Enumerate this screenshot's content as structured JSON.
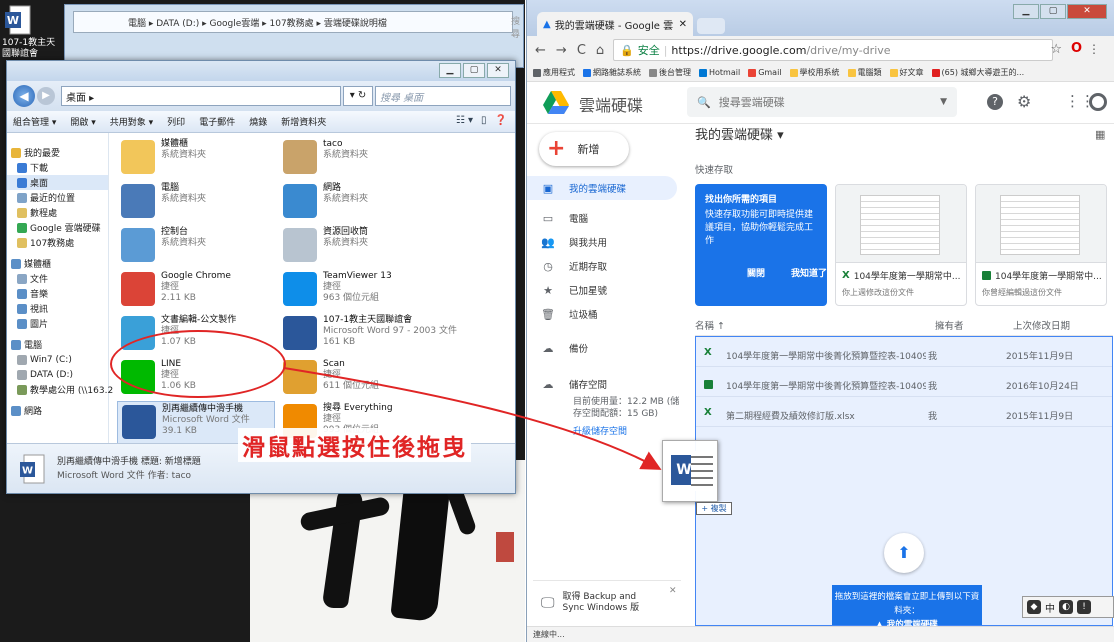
{
  "desktop": {
    "word_icon_label": "107-1教主天\n國聯誼會"
  },
  "bg_window": {
    "path": "電腦 ▸ DATA (D:) ▸ Google雲端 ▸ 107教務處 ▸ 雲端硬碟說明檔",
    "search": "搜尋"
  },
  "explorer": {
    "path": "桌面 ▸",
    "search_placeholder": "搜尋 桌面",
    "toolbar": [
      "組合管理 ▾",
      "開啟 ▾",
      "共用對象 ▾",
      "列印",
      "電子郵件",
      "燒錄",
      "新增資料夾"
    ],
    "nav": [
      {
        "label": "我的最愛",
        "group": true,
        "color": "#e8b53a"
      },
      {
        "label": "下載",
        "color": "#3a7bd5"
      },
      {
        "label": "桌面",
        "sel": true,
        "color": "#3a7bd5"
      },
      {
        "label": "最近的位置",
        "color": "#7fa3c8"
      },
      {
        "label": "數程處",
        "color": "#e0c060"
      },
      {
        "label": "Google 雲端硬碟",
        "color": "#34a853"
      },
      {
        "label": "107教務處",
        "color": "#e0c060"
      },
      {
        "label": "媒體櫃",
        "group": true,
        "color": "#5b8fc7"
      },
      {
        "label": "文件",
        "color": "#8aa6c4"
      },
      {
        "label": "音樂",
        "color": "#5b8fc7"
      },
      {
        "label": "視訊",
        "color": "#5b8fc7"
      },
      {
        "label": "圖片",
        "color": "#5b8fc7"
      },
      {
        "label": "電腦",
        "group": true,
        "color": "#5b8fc7"
      },
      {
        "label": "Win7 (C:)",
        "color": "#a0a8b0"
      },
      {
        "label": "DATA (D:)",
        "color": "#a0a8b0"
      },
      {
        "label": "教學處公用 (\\\\163.2",
        "color": "#7a9a5a"
      },
      {
        "label": "網路",
        "group": true,
        "color": "#5b8fc7"
      }
    ],
    "files": [
      {
        "name": "媒體櫃",
        "sub": "系統資料夾",
        "sub2": "",
        "color": "#f2c65a"
      },
      {
        "name": "taco",
        "sub": "系統資料夾",
        "sub2": "",
        "color": "#c9a36a"
      },
      {
        "name": "電腦",
        "sub": "系統資料夾",
        "sub2": "",
        "color": "#4a7ab8"
      },
      {
        "name": "網路",
        "sub": "系統資料夾",
        "sub2": "",
        "color": "#3a8ad0"
      },
      {
        "name": "控制台",
        "sub": "系統資料夾",
        "sub2": "",
        "color": "#5b9bd5"
      },
      {
        "name": "資源回收筒",
        "sub": "系統資料夾",
        "sub2": "",
        "color": "#b8c4d0"
      },
      {
        "name": "Google Chrome",
        "sub": "捷徑",
        "sub2": "2.11 KB",
        "color": "#db4437"
      },
      {
        "name": "TeamViewer 13",
        "sub": "捷徑",
        "sub2": "963 個位元組",
        "color": "#0e8ee9"
      },
      {
        "name": "文書編輯-公文製作",
        "sub": "捷徑",
        "sub2": "1.07 KB",
        "color": "#3aa0d8"
      },
      {
        "name": "107-1教主天國聯誼會",
        "sub": "Microsoft Word 97 - 2003 文件",
        "sub2": "161 KB",
        "color": "#2b579a"
      },
      {
        "name": "LINE",
        "sub": "捷徑",
        "sub2": "1.06 KB",
        "color": "#00b900"
      },
      {
        "name": "Scan",
        "sub": "捷徑",
        "sub2": "611 個位元組",
        "color": "#e0a030"
      },
      {
        "name": "別再繼續傳中滑手機",
        "sub": "Microsoft Word 文件",
        "sub2": "39.1 KB",
        "color": "#2b579a",
        "sel": true
      },
      {
        "name": "搜尋 Everything",
        "sub": "捷徑",
        "sub2": "993 個位元組",
        "color": "#f08a00"
      }
    ],
    "details_line1": "別再繼續傳中滑手機   標題: 新增標題",
    "details_line2": "Microsoft Word 文件   作者: taco"
  },
  "annotation": {
    "text": "滑鼠點選按住後拖曳"
  },
  "chrome": {
    "tab_title": "我的雲端硬碟 - Google 雲",
    "secure_label": "安全",
    "url_host": "https://drive.google.com",
    "url_path": "/drive/my-drive",
    "bookmarks": [
      {
        "label": "應用程式",
        "color": "#5f6368"
      },
      {
        "label": "網路雜誌系統",
        "color": "#1a73e8"
      },
      {
        "label": "後台管理",
        "color": "#888"
      },
      {
        "label": "Hotmail",
        "color": "#0078d4"
      },
      {
        "label": "Gmail",
        "color": "#ea4335"
      },
      {
        "label": "學校用系統",
        "color": "#f9c440"
      },
      {
        "label": "電腦類",
        "color": "#f9c440"
      },
      {
        "label": "好文章",
        "color": "#f9c440"
      },
      {
        "label": "(65) 城鄉大導遊王的...",
        "color": "#e02020"
      }
    ],
    "status": "連線中..."
  },
  "drive": {
    "name": "雲端硬碟",
    "search_placeholder": "搜尋雲端硬碟",
    "new_label": "新增",
    "side": [
      {
        "label": "我的雲端硬碟",
        "icon": "▣",
        "sel": true
      },
      {
        "label": "電腦",
        "icon": "▭"
      },
      {
        "label": "與我共用",
        "icon": "👥"
      },
      {
        "label": "近期存取",
        "icon": "◷"
      },
      {
        "label": "已加星號",
        "icon": "★"
      },
      {
        "label": "垃圾桶",
        "icon": "🗑"
      },
      {
        "label": "備份",
        "icon": "☁"
      },
      {
        "label": "儲存空間",
        "icon": "☁"
      }
    ],
    "storage_text": "目前使用量：12.2 MB (儲存空間配額：15 GB)",
    "storage_link": "升級儲存空間",
    "backup_text": "取得 Backup and Sync Windows 版",
    "title": "我的雲端硬碟 ▾",
    "quick_access": "快速存取",
    "promo_title": "找出你所需的項目",
    "promo_body": "快速存取功能可即時提供建議項目，協助你輕鬆完成工作",
    "promo_dismiss": "關閉",
    "promo_ok": "我知道了",
    "cards": [
      {
        "name": "104學年度第一學期常中...",
        "sub": "你上週修改這份文件",
        "kind": "xls"
      },
      {
        "name": "104學年度第一學期常中...",
        "sub": "你曾經編輯過這份文件",
        "kind": "sheet"
      }
    ],
    "columns": {
      "name": "名稱 ↑",
      "owner": "擁有者",
      "date": "上次修改日期"
    },
    "rows": [
      {
        "name": "104學年度第一學期常中後菁化預算暨控表-1040917...",
        "owner": "我",
        "date": "2015年11月9日",
        "kind": "xls"
      },
      {
        "name": "104學年度第一學期常中後菁化預算暨控表-1040917...",
        "owner": "我",
        "date": "2016年10月24日",
        "kind": "sheet"
      },
      {
        "name": "第二期程經費及績效修訂版.xlsx",
        "owner": "我",
        "date": "2015年11月9日",
        "kind": "xls"
      }
    ],
    "upload_banner_text": "拖放到這裡的檔案會立即上傳到以下資料夾：",
    "upload_banner_target": "我的雲端硬碟"
  },
  "drag": {
    "copy_badge": "+ 複製"
  },
  "ime": {
    "label": "中"
  }
}
